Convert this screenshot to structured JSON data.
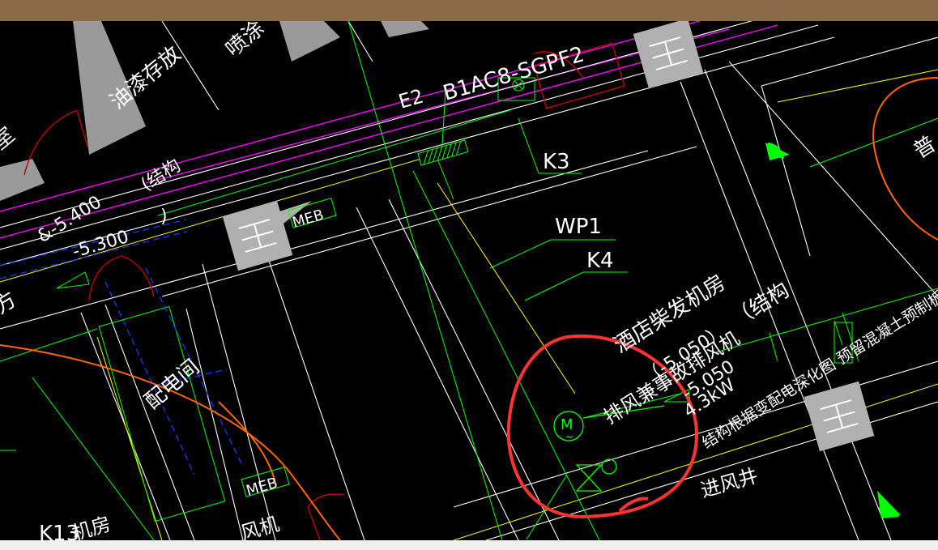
{
  "window": {
    "title_bar_color": "#8b6a47",
    "canvas_background": "#000000",
    "bottom_strip_color": "#f0f0f0"
  },
  "drawing": {
    "layer_colors": {
      "wall_fill": "#9a9a9a",
      "linework": "#ffffff",
      "equipment": "#00ff00",
      "annotation_text": "#ffffff",
      "duct": "#ff00ff",
      "dashed": "#0000ff",
      "door": "#c00000",
      "boundary": "#ff6600",
      "markup_circle": "#ff3333",
      "structure_fill": "#b0b0b0",
      "aux_line": "#ffff00"
    },
    "labels": {
      "room_paint": "油漆存放",
      "room_shi": "室",
      "room_pen": "喷涂",
      "duct_code": "B1AC8-SGPF2",
      "riser_e2": "E2",
      "tag_k3": "K3",
      "tag_wp1": "WP1",
      "tag_k4": "K4",
      "tag_k13": "K13",
      "elev_5400": "&-5.400",
      "elev_5300": "-5.300",
      "jiegou_left": "(结构",
      "paren_close": ")",
      "meb_top": "MEB",
      "meb_bottom": "MEB",
      "room_fang": "方",
      "room_power": "配电间",
      "room_diesel": "酒店柴发机房",
      "jiegou_right": "（结构",
      "fan_label": "排风兼事故排风机",
      "elev_050": "（-5.050）",
      "elev_5050": "-5.050",
      "power_kw": "4.3kW",
      "structure_note": "结构根据变配电深化图 预留混凝土预制板至标高",
      "intake_shaft": "进风井",
      "room_pu": "普",
      "room_fengji": "风机",
      "room_jifang": "机房",
      "motor_symbol": "M",
      "motor_wave": "~"
    }
  }
}
